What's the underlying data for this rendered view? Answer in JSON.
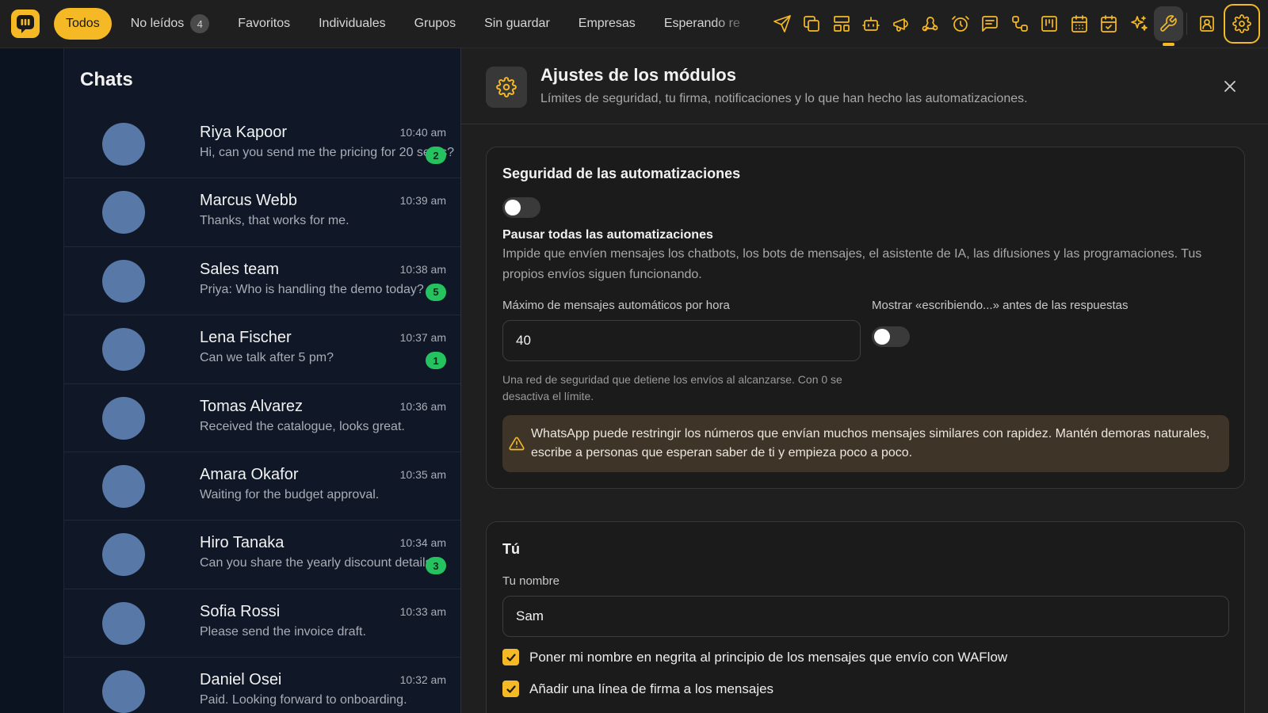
{
  "filters": [
    {
      "label": "Todos",
      "count": null
    },
    {
      "label": "No leídos",
      "count": "4"
    },
    {
      "label": "Favoritos",
      "count": null
    },
    {
      "label": "Individuales",
      "count": null
    },
    {
      "label": "Grupos",
      "count": null
    },
    {
      "label": "Sin guardar",
      "count": null
    },
    {
      "label": "Empresas",
      "count": null
    },
    {
      "label": "Esperando re",
      "count": null
    }
  ],
  "toolbar_icons": [
    "send-icon",
    "copy-icon",
    "layout-icon",
    "bot-icon",
    "megaphone-icon",
    "webhook-icon",
    "alarm-clock-icon",
    "message-square-icon",
    "workflow-icon",
    "kanban-icon",
    "calendar-grid-icon",
    "calendar-check-icon",
    "sparkles-icon",
    "wrench-icon",
    "contact-icon",
    "gear-icon"
  ],
  "chats": {
    "title": "Chats",
    "items": [
      {
        "name": "Riya Kapoor",
        "message": "Hi, can you send me the pricing for 20 seats?",
        "time": "10:40 am",
        "unread": "2"
      },
      {
        "name": "Marcus Webb",
        "message": "Thanks, that works for me.",
        "time": "10:39 am",
        "unread": null
      },
      {
        "name": "Sales team",
        "message": "Priya: Who is handling the demo today?",
        "time": "10:38 am",
        "unread": "5"
      },
      {
        "name": "Lena Fischer",
        "message": "Can we talk after 5 pm?",
        "time": "10:37 am",
        "unread": "1"
      },
      {
        "name": "Tomas Alvarez",
        "message": "Received the catalogue, looks great.",
        "time": "10:36 am",
        "unread": null
      },
      {
        "name": "Amara Okafor",
        "message": "Waiting for the budget approval.",
        "time": "10:35 am",
        "unread": null
      },
      {
        "name": "Hiro Tanaka",
        "message": "Can you share the yearly discount details?",
        "time": "10:34 am",
        "unread": "3"
      },
      {
        "name": "Sofia Rossi",
        "message": "Please send the invoice draft.",
        "time": "10:33 am",
        "unread": null
      },
      {
        "name": "Daniel Osei",
        "message": "Paid. Looking forward to onboarding.",
        "time": "10:32 am",
        "unread": null
      }
    ]
  },
  "settings": {
    "title": "Ajustes de los módulos",
    "subtitle": "Límites de seguridad, tu firma, notificaciones y lo que han hecho las automatizaciones.",
    "safety": {
      "title": "Seguridad de las automatizaciones",
      "pause_enabled": false,
      "pause_label": "Pausar todas las automatizaciones",
      "pause_desc": "Impide que envíen mensajes los chatbots, los bots de mensajes, el asistente de IA, las difusiones y las programaciones. Tus propios envíos siguen funcionando.",
      "max_label": "Máximo de mensajes automáticos por hora",
      "max_value": "40",
      "max_help": "Una red de seguridad que detiene los envíos al alcanzarse. Con 0 se desactiva el límite.",
      "typing_label": "Mostrar «escribiendo...» antes de las respuestas",
      "typing_enabled": false,
      "warning": "WhatsApp puede restringir los números que envían muchos mensajes similares con rapidez. Mantén demoras naturales, escribe a personas que esperan saber de ti y empieza poco a poco."
    },
    "you": {
      "title": "Tú",
      "name_label": "Tu nombre",
      "name_value": "Sam",
      "bold_name_label": "Poner mi nombre en negrita al principio de los mensajes que envío con WAFlow",
      "bold_name_checked": true,
      "signature_label": "Añadir una línea de firma a los mensajes",
      "signature_checked": true
    }
  },
  "colors": {
    "accent": "#f5b925",
    "unread": "#25c35f",
    "avatar": "#5878a8"
  }
}
